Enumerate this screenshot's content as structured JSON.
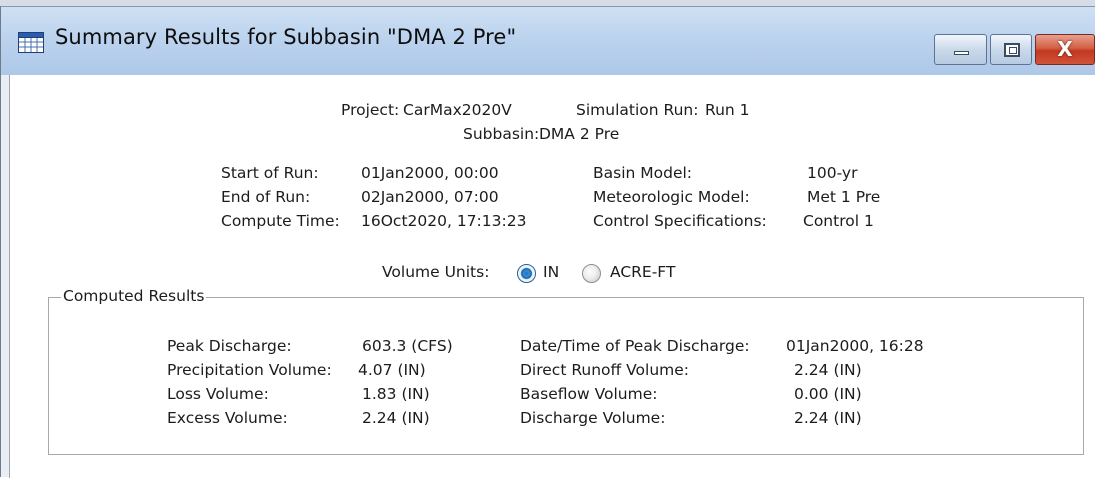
{
  "window": {
    "title": "Summary Results for Subbasin \"DMA 2 Pre\"",
    "controls": {
      "minimize": "minimize",
      "maximize": "maximize",
      "close": "X"
    }
  },
  "header": {
    "project_label": "Project:",
    "project_value": "CarMax2020V",
    "run_label": "Simulation Run:",
    "run_value": "Run 1",
    "subbasin_label": "Subbasin:",
    "subbasin_value": "DMA 2 Pre"
  },
  "run_info": {
    "left": [
      {
        "label": "Start of Run:",
        "value": "01Jan2000, 00:00"
      },
      {
        "label": "End of Run:",
        "value": "02Jan2000, 07:00"
      },
      {
        "label": "Compute Time:",
        "value": "16Oct2020, 17:13:23"
      }
    ],
    "right": [
      {
        "label": "Basin Model:",
        "value": "100-yr"
      },
      {
        "label": "Meteorologic Model:",
        "value": "Met 1 Pre"
      },
      {
        "label": "Control Specifications:",
        "value": "Control 1"
      }
    ]
  },
  "volume_units": {
    "label": "Volume Units:",
    "options": [
      {
        "label": "IN",
        "selected": true
      },
      {
        "label": "ACRE-FT",
        "selected": false
      }
    ]
  },
  "computed_results": {
    "title": "Computed Results",
    "left": [
      {
        "label": "Peak Discharge:",
        "value": "603.3 (CFS)"
      },
      {
        "label": "Precipitation Volume:",
        "value": "4.07 (IN)"
      },
      {
        "label": "Loss Volume:",
        "value": "1.83 (IN)"
      },
      {
        "label": "Excess Volume:",
        "value": "2.24 (IN)"
      }
    ],
    "right": [
      {
        "label": "Date/Time of Peak Discharge:",
        "value": "01Jan2000, 16:28"
      },
      {
        "label": "Direct Runoff Volume:",
        "value": "2.24 (IN)"
      },
      {
        "label": "Baseflow Volume:",
        "value": "0.00 (IN)"
      },
      {
        "label": "Discharge Volume:",
        "value": "2.24 (IN)"
      }
    ]
  }
}
